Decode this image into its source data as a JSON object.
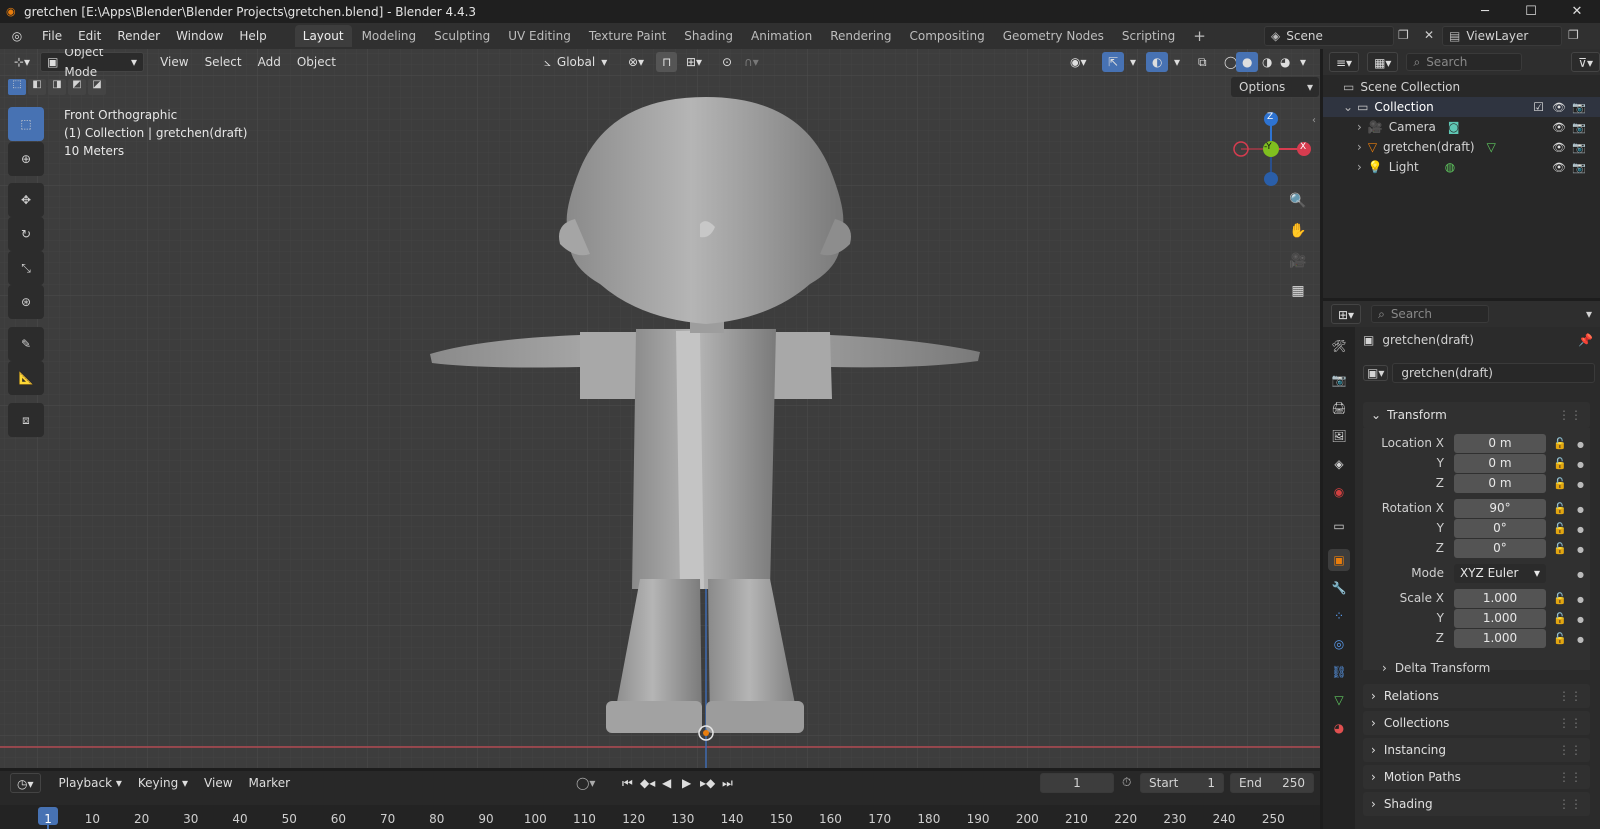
{
  "window": {
    "title": "gretchen [E:\\Apps\\Blender\\Blender Projects\\gretchen.blend] - Blender 4.4.3",
    "minimize": "─",
    "maximize": "☐",
    "close": "✕"
  },
  "menu": [
    "File",
    "Edit",
    "Render",
    "Window",
    "Help"
  ],
  "workspaces": [
    "Layout",
    "Modeling",
    "Sculpting",
    "UV Editing",
    "Texture Paint",
    "Shading",
    "Animation",
    "Rendering",
    "Compositing",
    "Geometry Nodes",
    "Scripting"
  ],
  "active_workspace": "Layout",
  "scene": {
    "name": "Scene",
    "view_layer": "ViewLayer"
  },
  "viewport": {
    "mode": "Object Mode",
    "menus": [
      "View",
      "Select",
      "Add",
      "Object"
    ],
    "orientation": "Global",
    "options_label": "Options",
    "overlay": {
      "view": "Front Orthographic",
      "collection": "(1) Collection | gretchen(draft)",
      "scale": "10 Meters"
    },
    "gizmo": {
      "z": "Z",
      "y": "-Y",
      "x": "X"
    }
  },
  "outliner": {
    "search_placeholder": "Search",
    "root": "Scene Collection",
    "collection": "Collection",
    "items": [
      {
        "name": "Camera",
        "icon": "camera-icon"
      },
      {
        "name": "gretchen(draft)",
        "icon": "mesh-icon"
      },
      {
        "name": "Light",
        "icon": "light-icon"
      }
    ]
  },
  "properties": {
    "search_placeholder": "Search",
    "object_name": "gretchen(draft)",
    "datablock": "gretchen(draft)",
    "transform_title": "Transform",
    "location_label": "Location X",
    "rotation_label": "Rotation X",
    "scale_label": "Scale X",
    "y_label": "Y",
    "z_label": "Z",
    "location": [
      "0 m",
      "0 m",
      "0 m"
    ],
    "rotation": [
      "90°",
      "0°",
      "0°"
    ],
    "mode_label": "Mode",
    "mode": "XYZ Euler",
    "scale": [
      "1.000",
      "1.000",
      "1.000"
    ],
    "delta": "Delta Transform",
    "panels": [
      "Relations",
      "Collections",
      "Instancing",
      "Motion Paths",
      "Shading"
    ]
  },
  "timeline": {
    "menus": [
      "Playback",
      "Keying",
      "View",
      "Marker"
    ],
    "current_frame": "1",
    "start_label": "Start",
    "start": "1",
    "end_label": "End",
    "end": "250",
    "ruler": [
      "1",
      "10",
      "20",
      "30",
      "40",
      "50",
      "60",
      "70",
      "80",
      "90",
      "100",
      "110",
      "120",
      "130",
      "140",
      "150",
      "160",
      "170",
      "180",
      "190",
      "200",
      "210",
      "220",
      "230",
      "240",
      "250"
    ]
  },
  "colors": {
    "accent": "#4772b3",
    "x_axis": "#d63c4f",
    "y_axis": "#7fbf1f",
    "z_axis": "#2e73d1",
    "orange": "#e87d0d"
  }
}
